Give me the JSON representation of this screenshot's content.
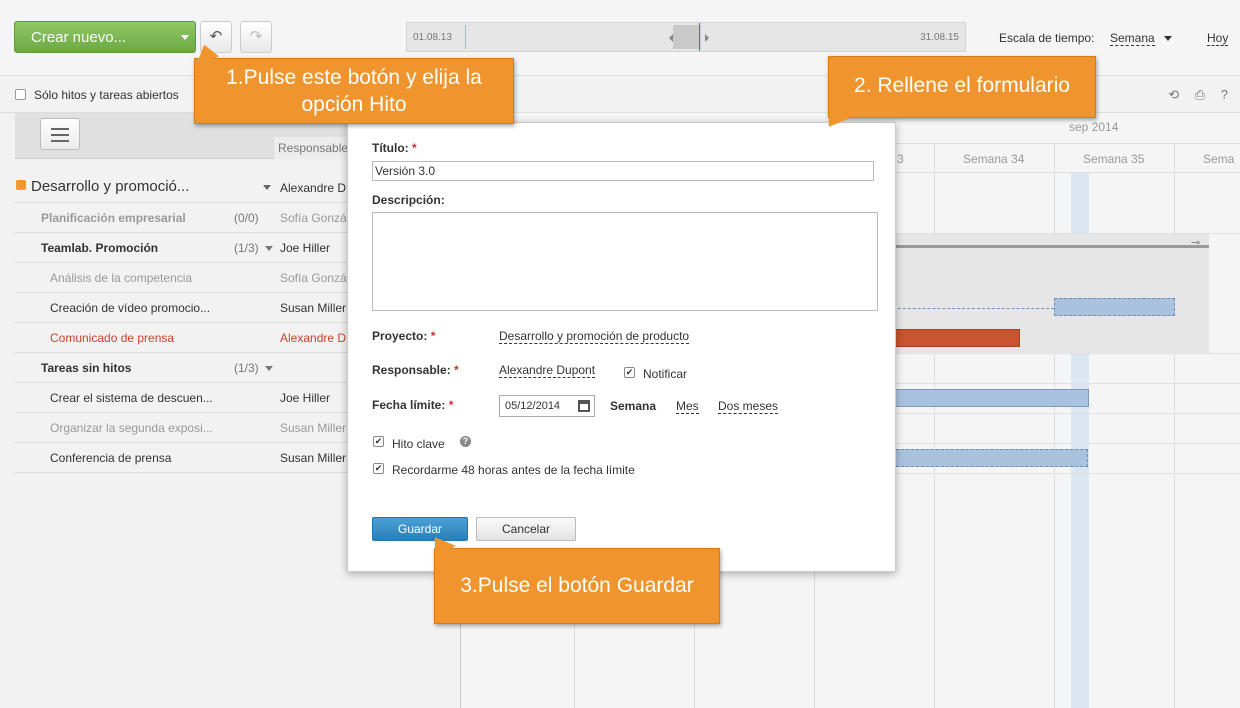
{
  "toolbar": {
    "create_label": "Crear nuevo...",
    "timeline_start": "01.08.13",
    "timeline_end": "31.08.15",
    "scale_label": "Escala de tiempo:",
    "scale_value": "Semana",
    "today_label": "Hoy"
  },
  "filter": {
    "label": "Sólo hitos y tareas abiertos"
  },
  "left": {
    "col_responsable": "Responsable",
    "project": {
      "name": "Desarrollo y promoció...",
      "resp": "Alexandre D"
    },
    "rows": [
      {
        "name": "Planificación empresarial",
        "count": "(0/0)",
        "resp": "Sofía Gonzá"
      },
      {
        "name": "Teamlab. Promoción",
        "count": "(1/3)",
        "resp": "Joe Hiller"
      },
      {
        "name": "Análisis de la competencia",
        "resp": "Sofía Gonzá"
      },
      {
        "name": "Creación de vídeo promocio...",
        "resp": "Susan Miller"
      },
      {
        "name": "Comunicado de prensa",
        "resp": "Alexandre D"
      },
      {
        "name": "Tareas sin hitos",
        "count": "(1/3)",
        "resp": ""
      },
      {
        "name": "Crear el sistema de descuen...",
        "resp": "Joe Hiller"
      },
      {
        "name": "Organizar la segunda exposi...",
        "resp": "Susan Miller"
      },
      {
        "name": "Conferencia de prensa",
        "resp": "Susan Miller"
      }
    ]
  },
  "gantt": {
    "month": "sep 2014",
    "weeks": [
      "3",
      "Semana 34",
      "Semana 35",
      "Sema"
    ]
  },
  "form": {
    "title_label": "Título:",
    "title_value": "Versión 3.0",
    "desc_label": "Descripción:",
    "project_label": "Proyecto:",
    "project_value": "Desarrollo y promoción de producto",
    "resp_label": "Responsable:",
    "resp_value": "Alexandre Dupont",
    "notify_label": "Notificar",
    "deadline_label": "Fecha límite:",
    "deadline_value": "05/12/2014",
    "opt_week": "Semana",
    "opt_month": "Mes",
    "opt_two_months": "Dos meses",
    "milestone_label": "Hito clave",
    "remind_label": "Recordarme 48 horas antes de la fecha límite",
    "save_label": "Guardar",
    "cancel_label": "Cancelar"
  },
  "callouts": {
    "step1": "1.Pulse este botón y elija la opción Hito",
    "step2": "2. Rellene el formulario",
    "step3": "3.Pulse el botón Guardar"
  },
  "colors": {
    "create_button": "#6da844",
    "save_button": "#2b7fb8",
    "callout": "#f0952e",
    "overdue_task": "#c9432c"
  }
}
